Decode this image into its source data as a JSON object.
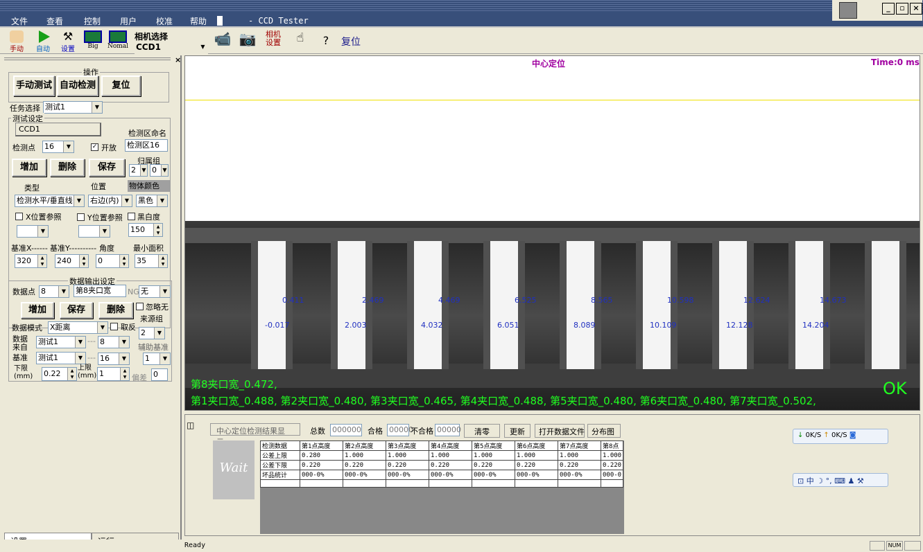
{
  "app": {
    "title": "- CCD Tester"
  },
  "menu": [
    "文件",
    "查看",
    "控制",
    "用户",
    "校准",
    "帮助"
  ],
  "toolbar": {
    "manual": "手动",
    "auto": "自动",
    "settings": "设置",
    "big": "Big",
    "normal": "Nomal",
    "camera_select_label": "相机选择",
    "camera_value": "CCD1",
    "camera_settings": "相机\n设置",
    "reset": "复位"
  },
  "left": {
    "ops_title": "操作",
    "manual_test": "手动测试",
    "auto_detect": "自动检测",
    "reset": "复位",
    "task_label": "任务选择",
    "task_value": "测试1",
    "test_settings": "测试设定",
    "ccd_value": "CCD1",
    "region_name_label": "检测区命名",
    "point_label": "检测点",
    "point_value": "16",
    "enable_label": "开放",
    "region_name_value": "检测区16",
    "add": "增加",
    "delete": "删除",
    "save": "保存",
    "group_label": "归属组",
    "group_a": "2",
    "group_b": "0",
    "type_label": "类型",
    "position_label": "位置",
    "object_color_label": "物体颜色",
    "type_value": "检测水平/垂直线",
    "position_value": "右边(内)",
    "color_value": "黑色",
    "x_ref": "X位置参照",
    "y_ref": "Y位置参照",
    "bw_label": "黑白度",
    "bw_value": "150",
    "base_x_label": "基准X------",
    "base_y_label": "基准Y----------",
    "angle_label": "角度",
    "min_area_label": "最小面积",
    "base_x": "320",
    "base_y": "240",
    "angle": "0",
    "min_area": "35",
    "output_title": "数据输出设定",
    "data_point_label": "数据点",
    "data_point_value": "8",
    "data_point_name": "第8夹口宽",
    "ng_label": "NG",
    "ng_value": "无",
    "add2": "增加",
    "save2": "保存",
    "delete2": "删除",
    "ignore_label": "忽略无",
    "source_group_label": "来源组",
    "mode_label": "数据模式",
    "mode_value": "X距离",
    "invert_label": "取反",
    "source_group_value": "2",
    "source_label": "数据\n来自",
    "source_value": "测试1",
    "source_num": "8",
    "aux_label": "辅助基准",
    "base_label": "基准",
    "base_value": "测试1",
    "base_num": "16",
    "aux_value": "1",
    "lower_label": "下限\n(mm)",
    "lower_value": "0.22",
    "upper_label": "上限\n(mm)",
    "upper_value": "1",
    "offset_label": "偏差",
    "offset_value": "0",
    "tabs": [
      "设置",
      "运行"
    ]
  },
  "image": {
    "title": "中心定位",
    "time": "Time:0 ms",
    "line1": "第8夹口宽_0.472,",
    "line2": "第1夹口宽_0.488, 第2夹口宽_0.480, 第3夹口宽_0.465, 第4夹口宽_0.488, 第5夹口宽_0.480, 第6夹口宽_0.480, 第7夹口宽_0.502,",
    "ok": "OK",
    "top_labels": [
      "0.411",
      "2.469",
      "4.469",
      "6.525",
      "8.565",
      "10.598",
      "12.624",
      "14.673"
    ],
    "bot_labels": [
      "-0.017",
      "2.003",
      "4.032",
      "6.051",
      "8.089",
      "10.109",
      "12.128",
      "14.204"
    ]
  },
  "results": {
    "title": "中心定位检测结果显示:",
    "total_label": "总数",
    "total": "000000",
    "pass_label": "合格",
    "pass": "00000",
    "fail_label": "不合格",
    "fail": "00000",
    "clear": "清零",
    "update": "更新",
    "open_file": "打开数据文件",
    "distribution": "分布图",
    "wait": "Wait",
    "headers": [
      "检测数据",
      "第1点高度",
      "第2点高度",
      "第3点高度",
      "第4点高度",
      "第5点高度",
      "第6点高度",
      "第7点高度",
      "第8点"
    ],
    "rows": [
      [
        "公差上限",
        "0.280",
        "1.000",
        "1.000",
        "1.000",
        "1.000",
        "1.000",
        "1.000",
        "1.000"
      ],
      [
        "公差下限",
        "0.220",
        "0.220",
        "0.220",
        "0.220",
        "0.220",
        "0.220",
        "0.220",
        "0.220"
      ],
      [
        "坏品统计",
        "000-0%",
        "000-0%",
        "000-0%",
        "000-0%",
        "000-0%",
        "000-0%",
        "000-0%",
        "000-0"
      ]
    ]
  },
  "net": {
    "down": "0K/S",
    "up": "0K/S"
  },
  "ime": "中",
  "status": {
    "ready": "Ready",
    "num": "NUM"
  }
}
